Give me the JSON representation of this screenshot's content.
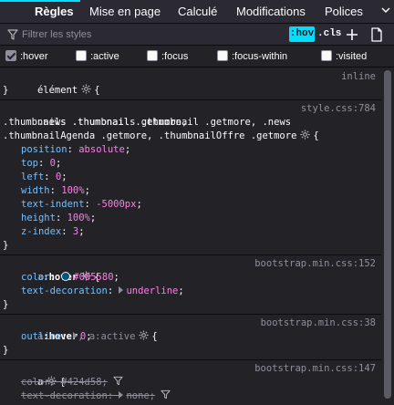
{
  "tabs": [
    {
      "label": "Règles",
      "selected": true
    },
    {
      "label": "Mise en page",
      "selected": false
    },
    {
      "label": "Calculé",
      "selected": false
    },
    {
      "label": "Modifications",
      "selected": false
    },
    {
      "label": "Polices",
      "selected": false
    }
  ],
  "overflow_icon": "chevron-down-icon",
  "toolbar": {
    "filter_placeholder": "Filtrer les styles",
    "hov_label": ":hov",
    "cls_label": ".cls",
    "add_icon": "plus-icon",
    "print_icon": "document-icon"
  },
  "pseudo_classes": [
    {
      "label": ":hover",
      "checked": true
    },
    {
      "label": ":active",
      "checked": false
    },
    {
      "label": ":focus",
      "checked": false
    },
    {
      "label": ":focus-within",
      "checked": false
    },
    {
      "label": ":visited",
      "checked": false
    }
  ],
  "colors": {
    "accent": "#00ddff",
    "property": "#75bfff",
    "value": "#ff7de9",
    "swatch": "#005580"
  },
  "rules": [
    {
      "selector": "élément",
      "source": "inline",
      "open": "{",
      "close": "}"
    },
    {
      "selector_lines": [
        ".news .thumbnails .thumbnail .getmore, .news",
        ".thumbnails .thumbnail .getmore,",
        ".thumbnailAgenda .getmore, .thumbnailOffre .getmore"
      ],
      "source": "style.css:784",
      "open": "{",
      "close": "}",
      "declarations": [
        {
          "property": "position",
          "value": "absolute"
        },
        {
          "property": "top",
          "value": "0"
        },
        {
          "property": "left",
          "value": "0"
        },
        {
          "property": "width",
          "value": "100%"
        },
        {
          "property": "text-indent",
          "value": "-5000px"
        },
        {
          "property": "height",
          "value": "100%"
        },
        {
          "property": "z-index",
          "value": "3"
        }
      ]
    },
    {
      "selector_parts": [
        "a",
        ":hover"
      ],
      "source": "bootstrap.min.css:152",
      "open": "{",
      "close": "}",
      "declarations": [
        {
          "property": "color",
          "value": "#005580"
        },
        {
          "property": "text-decoration",
          "value": "underline"
        }
      ]
    },
    {
      "selector_parts": [
        "a",
        ":hover",
        ", a:active"
      ],
      "source": "bootstrap.min.css:38",
      "open": "{",
      "close": "}",
      "declarations": [
        {
          "property": "outline",
          "value": "0"
        }
      ]
    },
    {
      "selector": "a",
      "source": "bootstrap.min.css:147",
      "open": "{",
      "declarations": [
        {
          "property": "color",
          "value": "#424d58"
        },
        {
          "property": "text-decoration",
          "value": "none"
        }
      ]
    }
  ]
}
